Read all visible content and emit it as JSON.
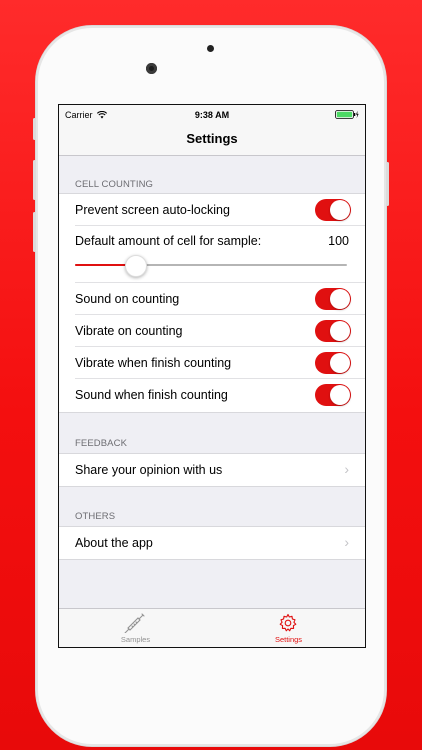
{
  "status_bar": {
    "carrier": "Carrier",
    "time": "9:38 AM"
  },
  "nav": {
    "title": "Settings"
  },
  "sections": {
    "cell_counting": {
      "header": "CELL COUNTING",
      "prevent_lock": {
        "label": "Prevent screen auto-locking",
        "on": true
      },
      "default_amount": {
        "label": "Default amount of cell for sample:",
        "value": "100",
        "slider_fraction": 0.22
      },
      "sound_counting": {
        "label": "Sound on counting",
        "on": true
      },
      "vibrate_counting": {
        "label": "Vibrate on counting",
        "on": true
      },
      "vibrate_finish": {
        "label": "Vibrate when finish counting",
        "on": true
      },
      "sound_finish": {
        "label": "Sound when finish counting",
        "on": true
      }
    },
    "feedback": {
      "header": "FEEDBACK",
      "share": {
        "label": "Share your opinion with us"
      }
    },
    "others": {
      "header": "OTHERS",
      "about": {
        "label": "About the app"
      }
    }
  },
  "tabs": {
    "samples": {
      "label": "Samples",
      "icon": "syringe-icon",
      "active": false
    },
    "settings": {
      "label": "Settings",
      "icon": "gear-icon",
      "active": true
    }
  },
  "colors": {
    "accent": "#e01010",
    "inactive": "#929292",
    "background": "#efeff4"
  }
}
